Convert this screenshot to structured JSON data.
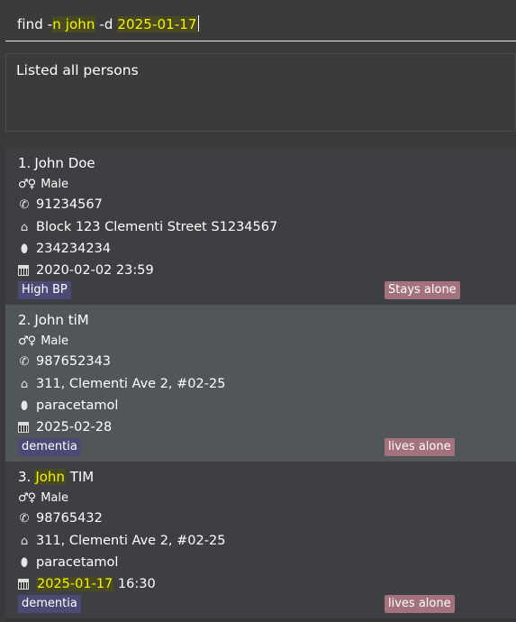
{
  "command": {
    "prefix": "find -",
    "name_flag": "n john",
    "mid": " -d ",
    "date_value": "2025-01-17"
  },
  "result": {
    "message": "Listed all persons"
  },
  "icons": {
    "gender": "♂♀",
    "phone": "📞",
    "home": "🏠",
    "pill": "💊"
  },
  "persons": [
    {
      "index": "1.",
      "name": "John Doe",
      "gender": "Male",
      "phone": "91234567",
      "address": "Block 123 Clementi Street S1234567",
      "medication": "234234234",
      "date": "2020-02-02 23:59",
      "condition_tag": "High BP",
      "living_tag": "Stays alone"
    },
    {
      "index": "2.",
      "name": "John tiM",
      "gender": "Male",
      "phone": "987652343",
      "address": "311, Clementi Ave 2, #02-25",
      "medication": "paracetamol",
      "date": "2025-02-28",
      "condition_tag": "dementia",
      "living_tag": "lives alone"
    },
    {
      "index": "3.",
      "name_highlight": "John",
      "name_rest": " TIM",
      "gender": "Male",
      "phone": "98765432",
      "address": "311, Clementi Ave 2, #02-25",
      "medication": "paracetamol",
      "date_highlight": "2025-01-17",
      "date_rest": " 16:30",
      "condition_tag": "dementia",
      "living_tag": "lives alone"
    }
  ],
  "colors": {
    "highlight": "#f5f500",
    "condition_tag_bg": "#4c4a74",
    "living_tag_bg": "#a4717e",
    "card_odd_bg": "#3d3f42",
    "card_even_bg": "#515658"
  }
}
